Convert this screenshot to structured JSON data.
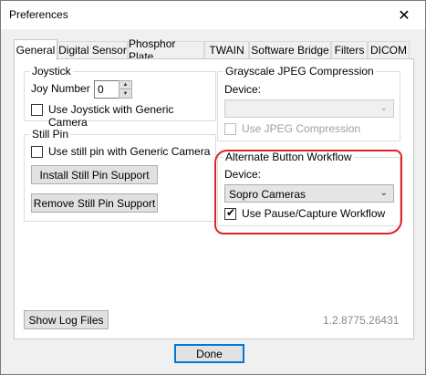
{
  "window": {
    "title": "Preferences",
    "close_label": "✕"
  },
  "tabs": [
    {
      "label": "General",
      "active": true
    },
    {
      "label": "Digital Sensor"
    },
    {
      "label": "Phosphor Plate"
    },
    {
      "label": "TWAIN"
    },
    {
      "label": "Software Bridge"
    },
    {
      "label": "Filters"
    },
    {
      "label": "DICOM"
    }
  ],
  "joystick": {
    "group_label": "Joystick",
    "joy_number_label": "Joy Number",
    "joy_number_value": "0",
    "generic_camera_label": "Use Joystick with Generic Camera",
    "generic_camera_checked": false
  },
  "still_pin": {
    "group_label": "Still Pin",
    "generic_camera_label": "Use still pin with Generic Camera",
    "generic_camera_checked": false,
    "install_label": "Install Still Pin Support",
    "remove_label": "Remove Still Pin Support"
  },
  "grayscale": {
    "group_label": "Grayscale JPEG Compression",
    "device_label": "Device:",
    "device_value": "",
    "use_jpeg_label": "Use JPEG Compression",
    "use_jpeg_checked": false
  },
  "alternate": {
    "group_label": "Alternate Button Workflow",
    "device_label": "Device:",
    "device_value": "Sopro Cameras",
    "pause_capture_label": "Use Pause/Capture Workflow",
    "pause_capture_checked": true
  },
  "footer": {
    "show_log_label": "Show Log Files",
    "version": "1.2.8775.26431",
    "done_label": "Done"
  },
  "colors": {
    "annotation": "#e1222b",
    "focus": "#0078d7"
  },
  "icons": {
    "dropdown": "chevron-down-icon",
    "check": "checkmark-icon",
    "close": "close-icon"
  }
}
